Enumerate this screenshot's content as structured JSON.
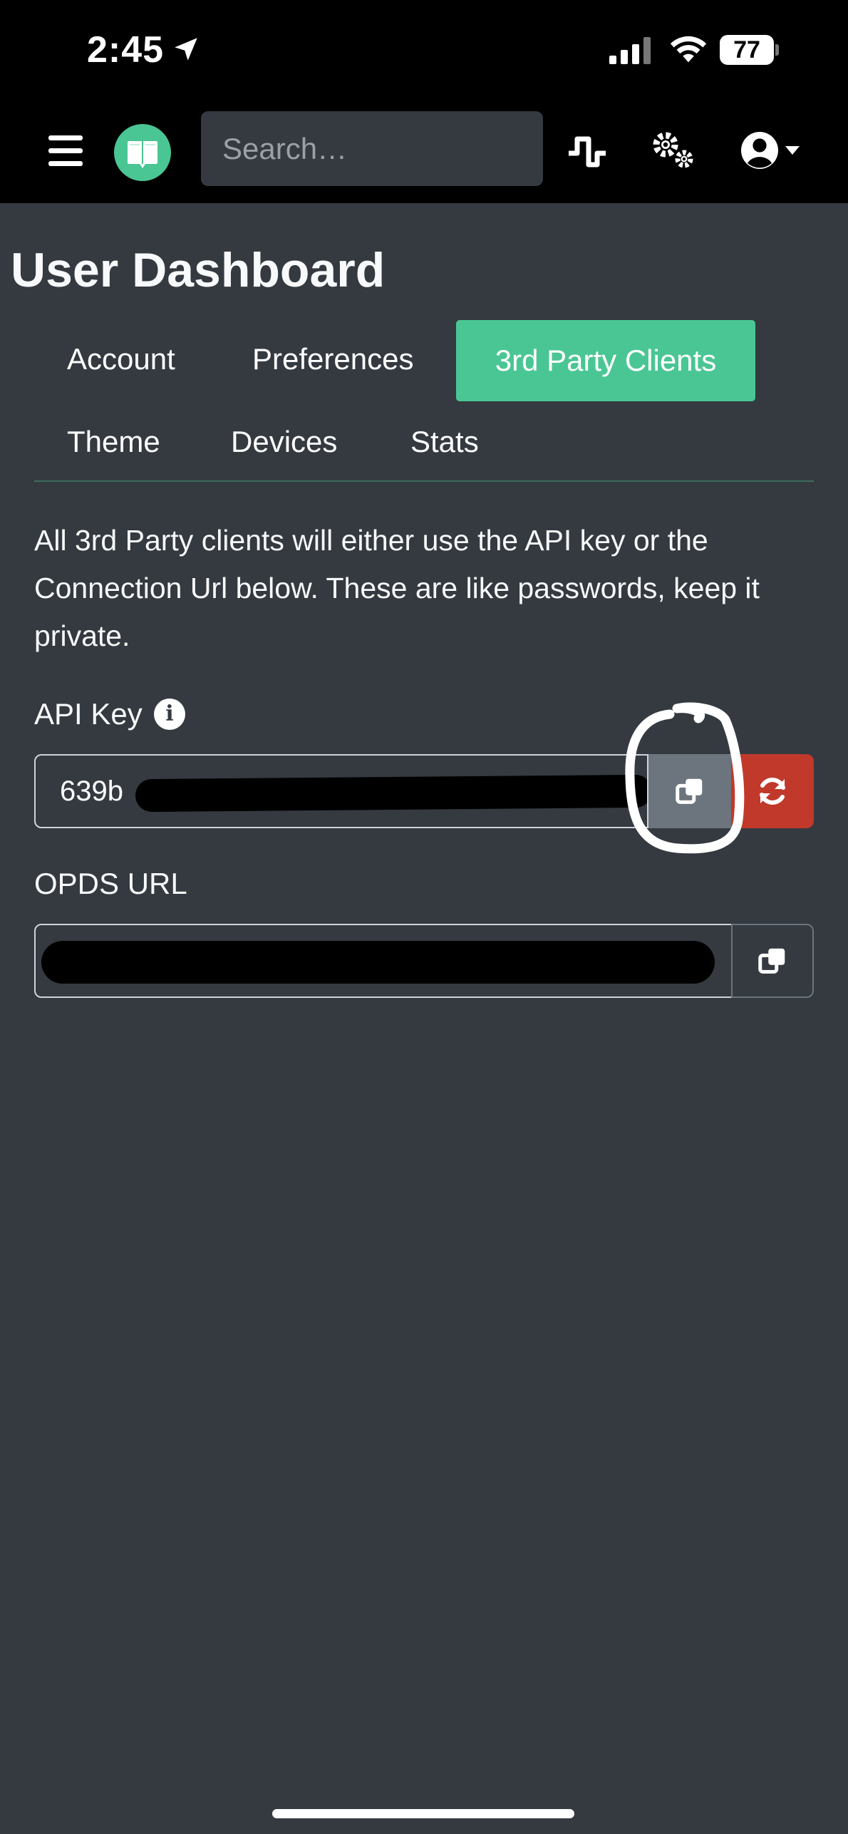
{
  "status_bar": {
    "time": "2:45",
    "battery": "77"
  },
  "navbar": {
    "search_placeholder": "Search…",
    "icons": [
      "hamburger-menu-icon",
      "book-logo-icon",
      "activity-pulse-icon",
      "settings-gears-icon",
      "user-account-icon"
    ],
    "logo_color": "#4ac694"
  },
  "page": {
    "title": "User Dashboard"
  },
  "tabs": [
    {
      "label": "Account",
      "active": false
    },
    {
      "label": "Preferences",
      "active": false
    },
    {
      "label": "3rd Party Clients",
      "active": true
    },
    {
      "label": "Theme",
      "active": false
    },
    {
      "label": "Devices",
      "active": false
    },
    {
      "label": "Stats",
      "active": false
    }
  ],
  "description": "All 3rd Party clients will either use the API key or the Connection Url below. These are like passwords, keep it private.",
  "api_key": {
    "label": "API Key",
    "value_visible": "639b",
    "copy_icon": "copy-icon",
    "regenerate_icon": "sync-icon"
  },
  "opds": {
    "label": "OPDS URL",
    "copy_icon": "copy-icon"
  },
  "colors": {
    "accent": "#4ac694",
    "danger": "#c0392b",
    "secondary": "#6c757d",
    "background": "#343a40"
  }
}
